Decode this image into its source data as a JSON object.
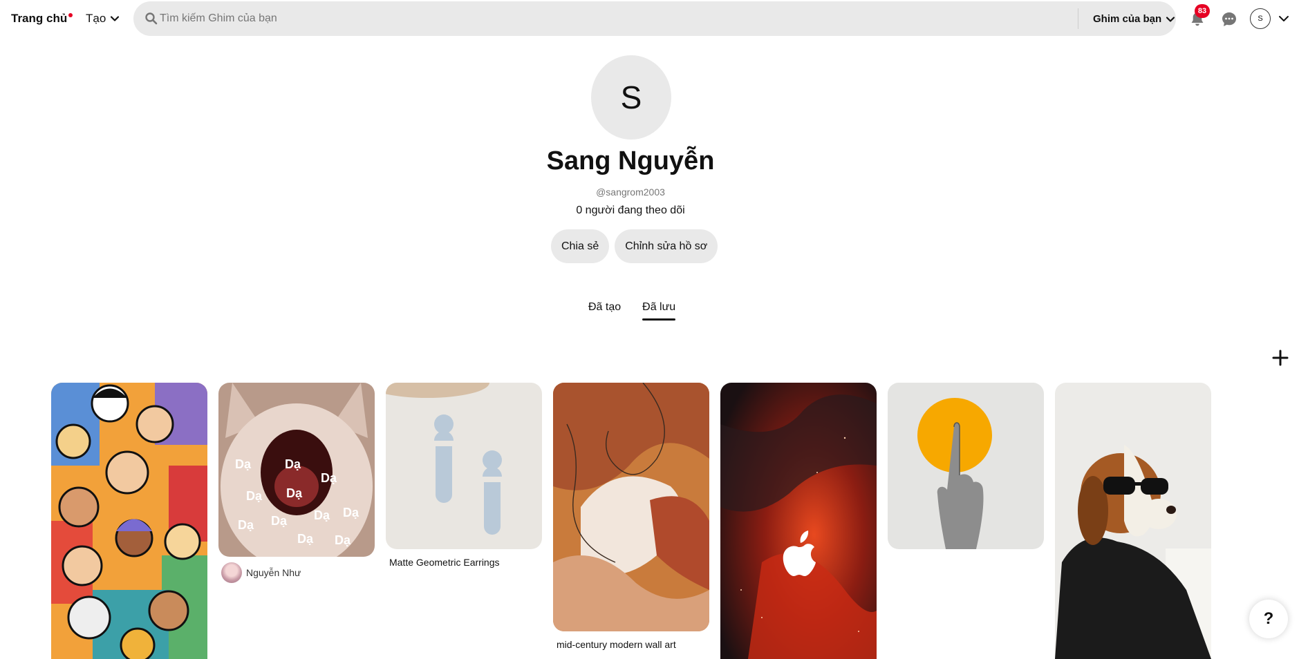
{
  "nav": {
    "home_label": "Trang chủ",
    "create_label": "Tạo",
    "search_placeholder": "Tìm kiếm Ghim của bạn",
    "search_value": "",
    "filter_label": "Ghim của bạn",
    "notification_count": "83",
    "account_initial": "S"
  },
  "profile": {
    "avatar_initial": "S",
    "name": "Sang Nguyễn",
    "handle": "@sangrom2003",
    "followers": "0 người đang theo dõi",
    "share_label": "Chia sẻ",
    "edit_label": "Chỉnh sửa hồ sơ"
  },
  "tabs": [
    {
      "label": "Đã tạo",
      "active": false
    },
    {
      "label": "Đã lưu",
      "active": true
    }
  ],
  "pins": [
    {
      "name": "cartoon-crowd",
      "caption": "",
      "author": ""
    },
    {
      "name": "cat-da",
      "caption": "",
      "author": "Nguyễn Như",
      "overlay_text": "Dạ"
    },
    {
      "name": "earrings",
      "caption": "Matte Geometric Earrings",
      "author": ""
    },
    {
      "name": "wall-art",
      "caption": "mid-century modern wall art",
      "author": ""
    },
    {
      "name": "nebula-apple",
      "caption": "",
      "author": ""
    },
    {
      "name": "hand-sun",
      "caption": "",
      "author": ""
    },
    {
      "name": "dog-sunglasses",
      "caption": "",
      "author": ""
    }
  ],
  "help_label": "?",
  "colors": {
    "brand_red": "#e60023",
    "pill_gray": "#e9e9e9",
    "text_dark": "#111111",
    "text_muted": "#767676"
  }
}
